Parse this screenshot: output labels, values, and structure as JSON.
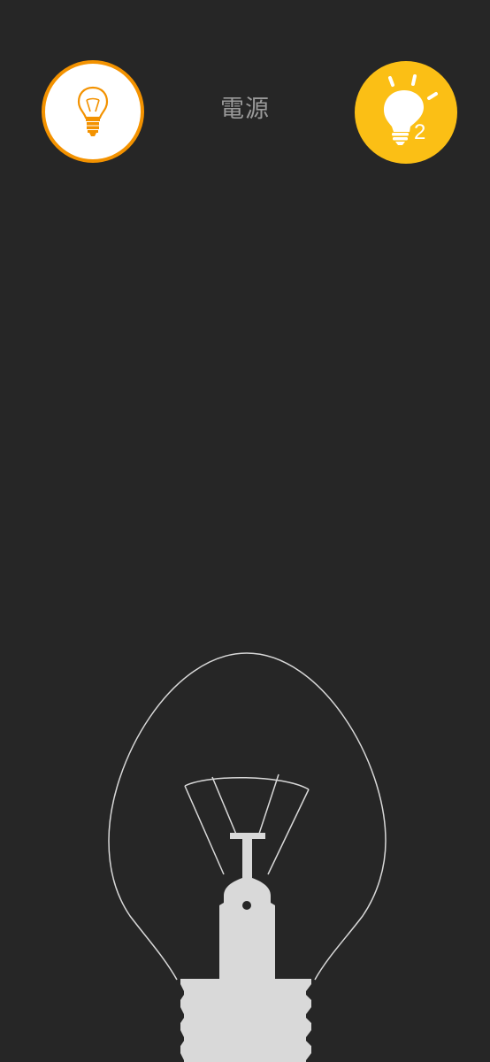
{
  "header": {
    "title": "電源",
    "bulb_count": "2"
  },
  "icons": {
    "left_button": "lightbulb-filament-icon",
    "right_button": "lightbulb-glow-icon",
    "main": "lightbulb-illustration"
  },
  "colors": {
    "background": "#262626",
    "accent_orange": "#f39200",
    "accent_yellow": "#fbbf15",
    "bulb_outline": "#d8d8d8",
    "bulb_base": "#d9d9d9",
    "title_text": "#9a9a9a"
  }
}
